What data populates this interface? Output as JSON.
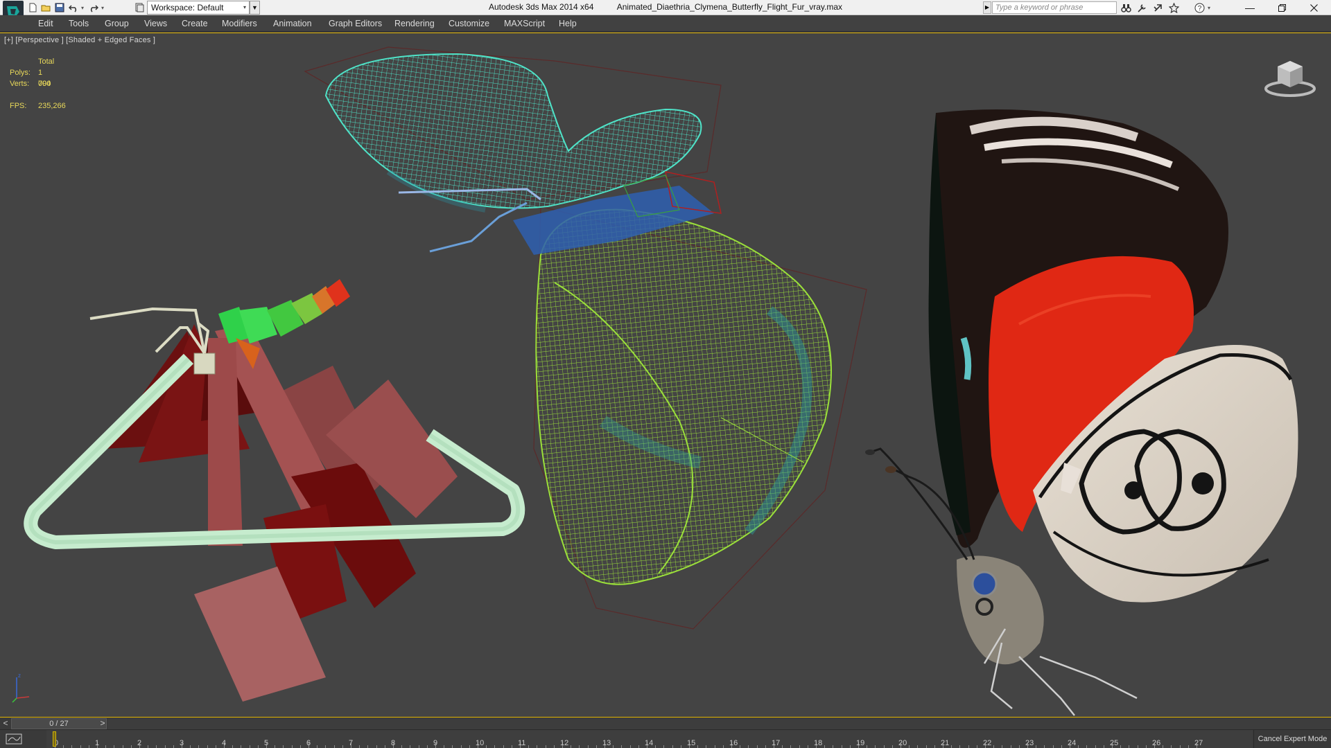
{
  "titlebar": {
    "workspace_label": "Workspace: Default",
    "app_title": "Autodesk 3ds Max  2014 x64",
    "file_title": "Animated_Diaethria_Clymena_Butterfly_Flight_Fur_vray.max",
    "search_placeholder": "Type a keyword or phrase"
  },
  "menu": [
    "Edit",
    "Tools",
    "Group",
    "Views",
    "Create",
    "Modifiers",
    "Animation",
    "Graph Editors",
    "Rendering",
    "Customize",
    "MAXScript",
    "Help"
  ],
  "viewport": {
    "label": "[+] [Perspective ] [Shaded + Edged Faces ]",
    "stats": {
      "header": "Total",
      "polys_label": "Polys:",
      "polys_value": "1 090",
      "verts_label": "Verts:",
      "verts_value": "704",
      "fps_label": "FPS:",
      "fps_value": "235,266"
    }
  },
  "timeline": {
    "prev": "<",
    "next": ">",
    "position": "0 / 27",
    "current_frame": 0,
    "total_frames": 27,
    "ticks": [
      "0",
      "1",
      "2",
      "3",
      "4",
      "5",
      "6",
      "7",
      "8",
      "9",
      "10",
      "11",
      "12",
      "13",
      "14",
      "15",
      "16",
      "17",
      "18",
      "19",
      "20",
      "21",
      "22",
      "23",
      "24",
      "25",
      "26",
      "27"
    ],
    "cancel_expert": "Cancel Expert Mode"
  },
  "colors": {
    "accent": "#e1b400",
    "viewport_bg": "#444444",
    "stats_text": "#e9d95a",
    "wire_cyan": "#4fe3c8",
    "wire_green": "#9be03a",
    "wing_red": "#e02814"
  }
}
